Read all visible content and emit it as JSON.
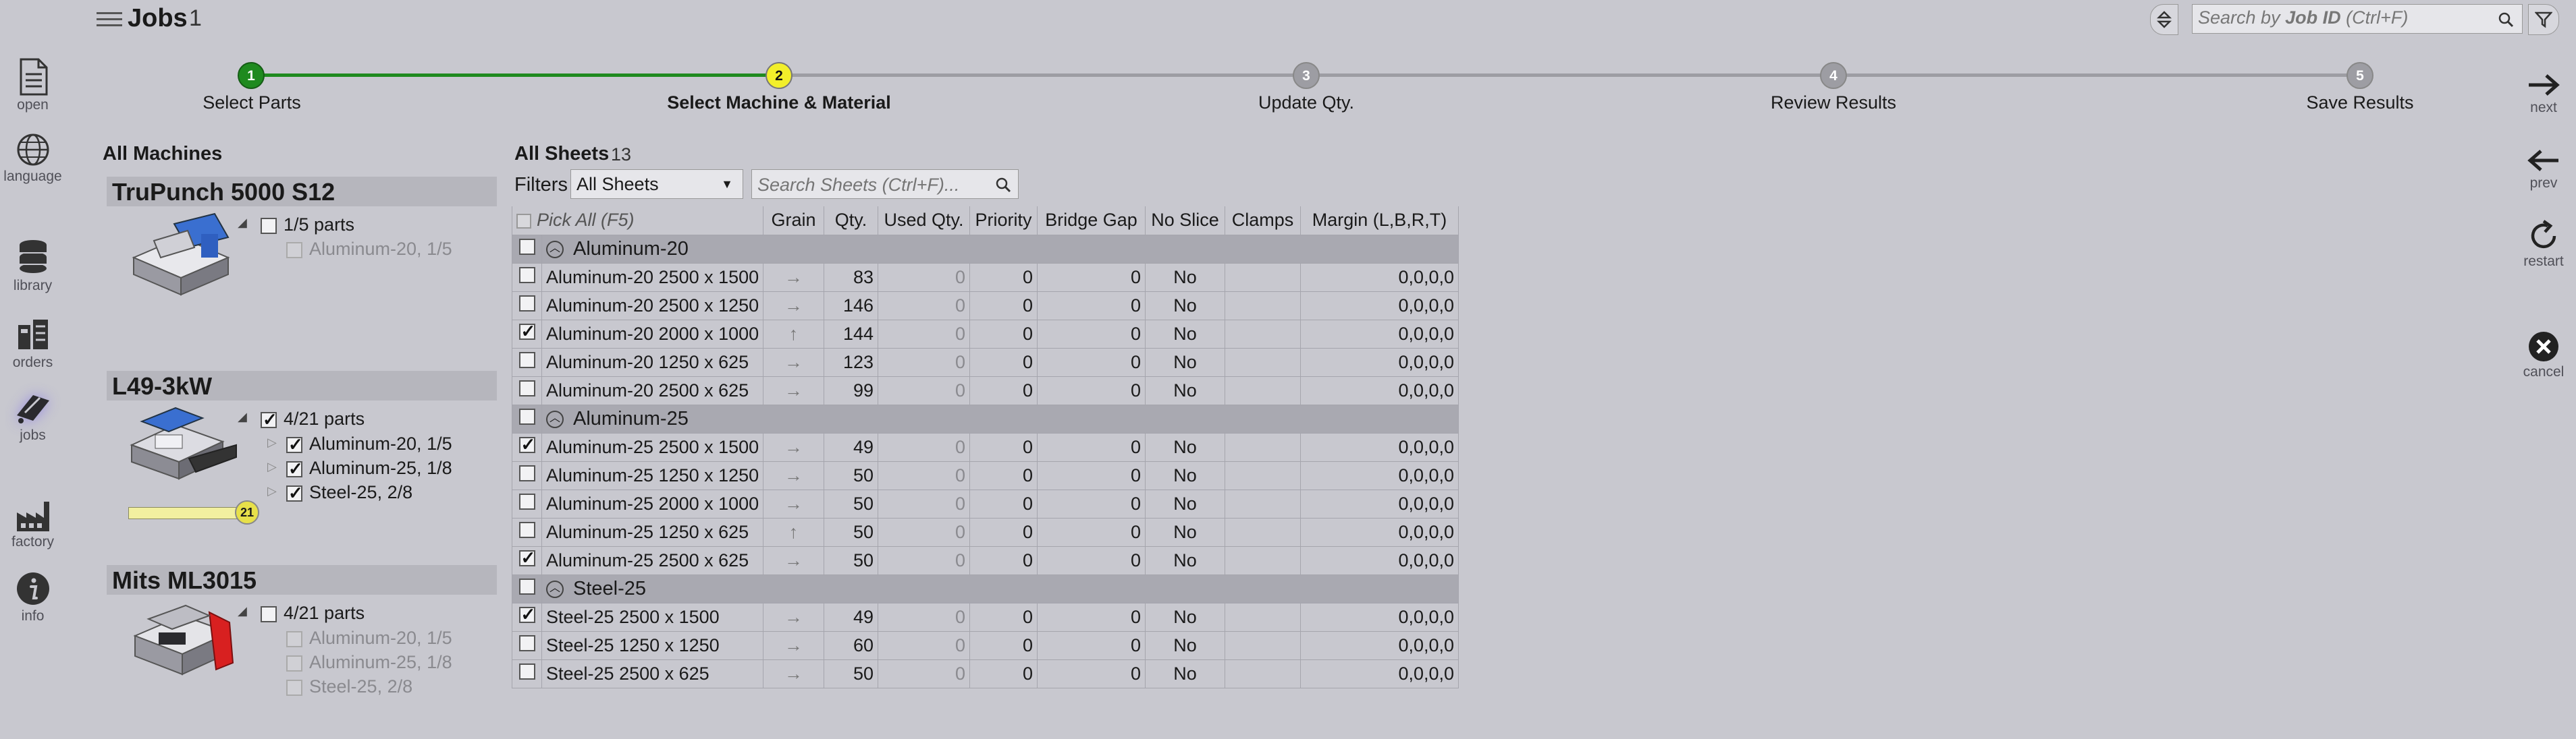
{
  "header": {
    "title": "Jobs",
    "count": "1",
    "search_placeholder": "Search by Job ID (Ctrl+F)",
    "search_placeholder_prefix": "Search by ",
    "search_placeholder_bold": "Job ID",
    "search_placeholder_suffix": " (Ctrl+F)"
  },
  "sidebar": {
    "items": [
      {
        "label": "open",
        "icon": "document-icon"
      },
      {
        "label": "language",
        "icon": "globe-icon"
      },
      {
        "label": "library",
        "icon": "database-icon"
      },
      {
        "label": "orders",
        "icon": "clipboard-icon"
      },
      {
        "label": "jobs",
        "icon": "jobs-icon",
        "active": true
      },
      {
        "label": "factory",
        "icon": "factory-icon"
      },
      {
        "label": "info",
        "icon": "info-icon"
      }
    ]
  },
  "stepper": {
    "steps": [
      {
        "num": "1",
        "label": "Select Parts",
        "state": "done"
      },
      {
        "num": "2",
        "label": "Select Machine & Material",
        "state": "current"
      },
      {
        "num": "3",
        "label": "Update Qty.",
        "state": "pending"
      },
      {
        "num": "4",
        "label": "Review Results",
        "state": "pending"
      },
      {
        "num": "5",
        "label": "Save Results",
        "state": "pending"
      }
    ],
    "colors": {
      "done": "#1f8a1f",
      "current": "#f2ef2a",
      "pending": "#9d9da3"
    }
  },
  "right_nav": {
    "next": "next",
    "prev": "prev",
    "restart": "restart",
    "cancel": "cancel"
  },
  "machines": {
    "title": "All Machines",
    "list": [
      {
        "name": "TruPunch 5000 S12",
        "summary": "1/5 parts",
        "summary_checked": false,
        "materials": [
          {
            "label": "Aluminum-20, 1/5",
            "checked": false,
            "disabled": true
          }
        ]
      },
      {
        "name": "L49-3kW",
        "summary": "4/21 parts",
        "summary_checked": true,
        "materials": [
          {
            "label": "Aluminum-20, 1/5",
            "checked": true,
            "disabled": false
          },
          {
            "label": "Aluminum-25, 1/8",
            "checked": true,
            "disabled": false
          },
          {
            "label": "Steel-25, 2/8",
            "checked": true,
            "disabled": false
          }
        ],
        "slider_value": "21"
      },
      {
        "name": "Mits ML3015",
        "summary": "4/21 parts",
        "summary_checked": false,
        "materials": [
          {
            "label": "Aluminum-20, 1/5",
            "checked": false,
            "disabled": true
          },
          {
            "label": "Aluminum-25, 1/8",
            "checked": false,
            "disabled": true
          },
          {
            "label": "Steel-25, 2/8",
            "checked": false,
            "disabled": true
          }
        ]
      }
    ]
  },
  "sheets": {
    "title": "All Sheets",
    "count": "13",
    "filters_label": "Filters",
    "filter_value": "All Sheets",
    "search_placeholder": "Search Sheets (Ctrl+F)...",
    "columns": [
      "Pick All (F5)",
      "Grain",
      "Qty.",
      "Used Qty.",
      "Priority",
      "Bridge Gap",
      "No Slice",
      "Clamps",
      "Margin (L,B,R,T)"
    ],
    "groups": [
      {
        "name": "Aluminum-20",
        "rows": [
          {
            "name": "Aluminum-20 2500 x 1500",
            "checked": false,
            "grain": "→",
            "qty": "83",
            "used": "0",
            "priority": "0",
            "gap": "0",
            "noslice": "No",
            "clamps": "",
            "margin": "0,0,0,0"
          },
          {
            "name": "Aluminum-20 2500 x 1250",
            "checked": false,
            "grain": "→",
            "qty": "146",
            "used": "0",
            "priority": "0",
            "gap": "0",
            "noslice": "No",
            "clamps": "",
            "margin": "0,0,0,0"
          },
          {
            "name": "Aluminum-20 2000 x 1000",
            "checked": true,
            "grain": "↑",
            "qty": "144",
            "used": "0",
            "priority": "0",
            "gap": "0",
            "noslice": "No",
            "clamps": "",
            "margin": "0,0,0,0"
          },
          {
            "name": "Aluminum-20 1250 x 625",
            "checked": false,
            "grain": "→",
            "qty": "123",
            "used": "0",
            "priority": "0",
            "gap": "0",
            "noslice": "No",
            "clamps": "",
            "margin": "0,0,0,0"
          },
          {
            "name": "Aluminum-20 2500 x 625",
            "checked": false,
            "grain": "→",
            "qty": "99",
            "used": "0",
            "priority": "0",
            "gap": "0",
            "noslice": "No",
            "clamps": "",
            "margin": "0,0,0,0"
          }
        ]
      },
      {
        "name": "Aluminum-25",
        "rows": [
          {
            "name": "Aluminum-25 2500 x 1500",
            "checked": true,
            "grain": "→",
            "qty": "49",
            "used": "0",
            "priority": "0",
            "gap": "0",
            "noslice": "No",
            "clamps": "",
            "margin": "0,0,0,0"
          },
          {
            "name": "Aluminum-25 1250 x 1250",
            "checked": false,
            "grain": "→",
            "qty": "50",
            "used": "0",
            "priority": "0",
            "gap": "0",
            "noslice": "No",
            "clamps": "",
            "margin": "0,0,0,0"
          },
          {
            "name": "Aluminum-25 2000 x 1000",
            "checked": false,
            "grain": "→",
            "qty": "50",
            "used": "0",
            "priority": "0",
            "gap": "0",
            "noslice": "No",
            "clamps": "",
            "margin": "0,0,0,0"
          },
          {
            "name": "Aluminum-25 1250 x 625",
            "checked": false,
            "grain": "↑",
            "qty": "50",
            "used": "0",
            "priority": "0",
            "gap": "0",
            "noslice": "No",
            "clamps": "",
            "margin": "0,0,0,0"
          },
          {
            "name": "Aluminum-25 2500 x 625",
            "checked": true,
            "grain": "→",
            "qty": "50",
            "used": "0",
            "priority": "0",
            "gap": "0",
            "noslice": "No",
            "clamps": "",
            "margin": "0,0,0,0"
          }
        ]
      },
      {
        "name": "Steel-25",
        "rows": [
          {
            "name": "Steel-25 2500 x 1500",
            "checked": true,
            "grain": "→",
            "qty": "49",
            "used": "0",
            "priority": "0",
            "gap": "0",
            "noslice": "No",
            "clamps": "",
            "margin": "0,0,0,0"
          },
          {
            "name": "Steel-25 1250 x 1250",
            "checked": false,
            "grain": "→",
            "qty": "60",
            "used": "0",
            "priority": "0",
            "gap": "0",
            "noslice": "No",
            "clamps": "",
            "margin": "0,0,0,0"
          },
          {
            "name": "Steel-25 2500 x 625",
            "checked": false,
            "grain": "→",
            "qty": "50",
            "used": "0",
            "priority": "0",
            "gap": "0",
            "noslice": "No",
            "clamps": "",
            "margin": "0,0,0,0"
          }
        ]
      }
    ]
  }
}
